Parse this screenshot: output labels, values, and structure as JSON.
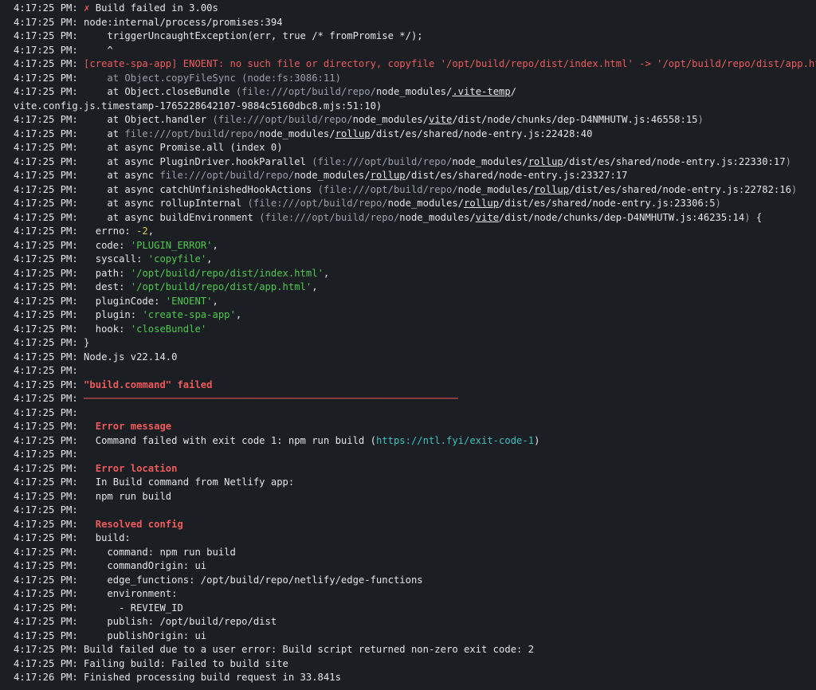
{
  "log": {
    "lines": [
      {
        "ts": "4:17:25 PM:",
        "segs": [
          {
            "t": " "
          },
          {
            "t": "✗",
            "c": "red"
          },
          {
            "t": " Build failed in 3.00s"
          }
        ]
      },
      {
        "ts": "4:17:25 PM:",
        "segs": [
          {
            "t": " node:internal/process/promises:394"
          }
        ]
      },
      {
        "ts": "4:17:25 PM:",
        "segs": [
          {
            "t": "     triggerUncaughtException(err, true /* fromPromise */);"
          }
        ]
      },
      {
        "ts": "4:17:25 PM:",
        "segs": [
          {
            "t": "     ^"
          }
        ]
      },
      {
        "ts": "4:17:25 PM:",
        "segs": [
          {
            "t": " [create-spa-app] ENOENT: no such file or directory, copyfile '/opt/build/repo/dist/index.html' -> '/opt/build/repo/dist/app.html'",
            "c": "red"
          }
        ]
      },
      {
        "ts": "4:17:25 PM:",
        "segs": [
          {
            "t": "     at Object.copyFileSync (node:fs:3086:11)",
            "c": "dim"
          }
        ]
      },
      {
        "ts": "4:17:25 PM:",
        "segs": [
          {
            "t": "     at Object.closeBundle "
          },
          {
            "t": "(file:///opt/build/repo/",
            "c": "dim"
          },
          {
            "t": "node_modules/"
          },
          {
            "t": ".vite-temp",
            "c": "u"
          },
          {
            "t": "/"
          }
        ]
      },
      {
        "ts": "",
        "segs": [
          {
            "t": "vite.config.js.timestamp-1765228642107-9884c5160dbc8.mjs:51:10)"
          }
        ]
      },
      {
        "ts": "4:17:25 PM:",
        "segs": [
          {
            "t": "     at Object.handler "
          },
          {
            "t": "(file:///opt/build/repo/",
            "c": "dim"
          },
          {
            "t": "node_modules/"
          },
          {
            "t": "vite",
            "c": "u"
          },
          {
            "t": "/dist/node/chunks/dep-D4NMHUTW.js:46558:15"
          },
          {
            "t": ")",
            "c": "dim"
          }
        ]
      },
      {
        "ts": "4:17:25 PM:",
        "segs": [
          {
            "t": "     at "
          },
          {
            "t": "file:///opt/build/repo/",
            "c": "dim"
          },
          {
            "t": "node_modules/"
          },
          {
            "t": "rollup",
            "c": "u"
          },
          {
            "t": "/dist/es/shared/node-entry.js:22428:40"
          }
        ]
      },
      {
        "ts": "4:17:25 PM:",
        "segs": [
          {
            "t": "     at async Promise.all (index 0)"
          }
        ]
      },
      {
        "ts": "4:17:25 PM:",
        "segs": [
          {
            "t": "     at async PluginDriver.hookParallel "
          },
          {
            "t": "(file:///opt/build/repo/",
            "c": "dim"
          },
          {
            "t": "node_modules/"
          },
          {
            "t": "rollup",
            "c": "u"
          },
          {
            "t": "/dist/es/shared/node-entry.js:22330:17"
          },
          {
            "t": ")",
            "c": "dim"
          }
        ]
      },
      {
        "ts": "4:17:25 PM:",
        "segs": [
          {
            "t": "     at async "
          },
          {
            "t": "file:///opt/build/repo/",
            "c": "dim"
          },
          {
            "t": "node_modules/"
          },
          {
            "t": "rollup",
            "c": "u"
          },
          {
            "t": "/dist/es/shared/node-entry.js:23327:17"
          }
        ]
      },
      {
        "ts": "4:17:25 PM:",
        "segs": [
          {
            "t": "     at async catchUnfinishedHookActions "
          },
          {
            "t": "(file:///opt/build/repo/",
            "c": "dim"
          },
          {
            "t": "node_modules/"
          },
          {
            "t": "rollup",
            "c": "u"
          },
          {
            "t": "/dist/es/shared/node-entry.js:22782:16"
          },
          {
            "t": ")",
            "c": "dim"
          }
        ]
      },
      {
        "ts": "4:17:25 PM:",
        "segs": [
          {
            "t": "     at async rollupInternal "
          },
          {
            "t": "(file:///opt/build/repo/",
            "c": "dim"
          },
          {
            "t": "node_modules/"
          },
          {
            "t": "rollup",
            "c": "u"
          },
          {
            "t": "/dist/es/shared/node-entry.js:23306:5"
          },
          {
            "t": ")",
            "c": "dim"
          }
        ]
      },
      {
        "ts": "4:17:25 PM:",
        "segs": [
          {
            "t": "     at async buildEnvironment "
          },
          {
            "t": "(file:///opt/build/repo/",
            "c": "dim"
          },
          {
            "t": "node_modules/"
          },
          {
            "t": "vite",
            "c": "u"
          },
          {
            "t": "/dist/node/chunks/dep-D4NMHUTW.js:46235:14"
          },
          {
            "t": ")",
            "c": "dim"
          },
          {
            "t": " {"
          }
        ]
      },
      {
        "ts": "4:17:25 PM:",
        "segs": [
          {
            "t": "   errno: "
          },
          {
            "t": "-2",
            "c": "num"
          },
          {
            "t": ","
          }
        ]
      },
      {
        "ts": "4:17:25 PM:",
        "segs": [
          {
            "t": "   code: "
          },
          {
            "t": "'PLUGIN_ERROR'",
            "c": "str"
          },
          {
            "t": ","
          }
        ]
      },
      {
        "ts": "4:17:25 PM:",
        "segs": [
          {
            "t": "   syscall: "
          },
          {
            "t": "'copyfile'",
            "c": "str"
          },
          {
            "t": ","
          }
        ]
      },
      {
        "ts": "4:17:25 PM:",
        "segs": [
          {
            "t": "   path: "
          },
          {
            "t": "'/opt/build/repo/dist/index.html'",
            "c": "str"
          },
          {
            "t": ","
          }
        ]
      },
      {
        "ts": "4:17:25 PM:",
        "segs": [
          {
            "t": "   dest: "
          },
          {
            "t": "'/opt/build/repo/dist/app.html'",
            "c": "str"
          },
          {
            "t": ","
          }
        ]
      },
      {
        "ts": "4:17:25 PM:",
        "segs": [
          {
            "t": "   pluginCode: "
          },
          {
            "t": "'ENOENT'",
            "c": "str"
          },
          {
            "t": ","
          }
        ]
      },
      {
        "ts": "4:17:25 PM:",
        "segs": [
          {
            "t": "   plugin: "
          },
          {
            "t": "'create-spa-app'",
            "c": "str"
          },
          {
            "t": ","
          }
        ]
      },
      {
        "ts": "4:17:25 PM:",
        "segs": [
          {
            "t": "   hook: "
          },
          {
            "t": "'closeBundle'",
            "c": "str"
          }
        ]
      },
      {
        "ts": "4:17:25 PM:",
        "segs": [
          {
            "t": " }"
          }
        ]
      },
      {
        "ts": "4:17:25 PM:",
        "segs": [
          {
            "t": " Node.js v22.14.0"
          }
        ]
      },
      {
        "ts": "4:17:25 PM:",
        "segs": []
      },
      {
        "ts": "4:17:25 PM:",
        "segs": [
          {
            "t": " \"build.command\" failed",
            "c": "redb"
          }
        ]
      },
      {
        "ts": "4:17:25 PM:",
        "segs": [
          {
            "t": " ────────────────────────────────────────────────────────────────",
            "c": "red"
          }
        ]
      },
      {
        "ts": "4:17:25 PM:",
        "segs": []
      },
      {
        "ts": "4:17:25 PM:",
        "segs": [
          {
            "t": "   "
          },
          {
            "t": "Error message",
            "c": "redb"
          }
        ]
      },
      {
        "ts": "4:17:25 PM:",
        "segs": [
          {
            "t": "   Command failed with exit code 1: npm run build ("
          },
          {
            "t": "https://ntl.fyi/exit-code-1",
            "c": "link"
          },
          {
            "t": ")"
          }
        ]
      },
      {
        "ts": "4:17:25 PM:",
        "segs": []
      },
      {
        "ts": "4:17:25 PM:",
        "segs": [
          {
            "t": "   "
          },
          {
            "t": "Error location",
            "c": "redb"
          }
        ]
      },
      {
        "ts": "4:17:25 PM:",
        "segs": [
          {
            "t": "   In Build command from Netlify app:"
          }
        ]
      },
      {
        "ts": "4:17:25 PM:",
        "segs": [
          {
            "t": "   npm run build"
          }
        ]
      },
      {
        "ts": "4:17:25 PM:",
        "segs": []
      },
      {
        "ts": "4:17:25 PM:",
        "segs": [
          {
            "t": "   "
          },
          {
            "t": "Resolved config",
            "c": "redb"
          }
        ]
      },
      {
        "ts": "4:17:25 PM:",
        "segs": [
          {
            "t": "   build:"
          }
        ]
      },
      {
        "ts": "4:17:25 PM:",
        "segs": [
          {
            "t": "     command: npm run build"
          }
        ]
      },
      {
        "ts": "4:17:25 PM:",
        "segs": [
          {
            "t": "     commandOrigin: ui"
          }
        ]
      },
      {
        "ts": "4:17:25 PM:",
        "segs": [
          {
            "t": "     edge_functions: /opt/build/repo/netlify/edge-functions"
          }
        ]
      },
      {
        "ts": "4:17:25 PM:",
        "segs": [
          {
            "t": "     environment:"
          }
        ]
      },
      {
        "ts": "4:17:25 PM:",
        "segs": [
          {
            "t": "       - REVIEW_ID"
          }
        ]
      },
      {
        "ts": "4:17:25 PM:",
        "segs": [
          {
            "t": "     publish: /opt/build/repo/dist"
          }
        ]
      },
      {
        "ts": "4:17:25 PM:",
        "segs": [
          {
            "t": "     publishOrigin: ui"
          }
        ]
      },
      {
        "ts": "4:17:25 PM:",
        "segs": [
          {
            "t": " Build failed due to a user error: Build script returned non-zero exit code: 2"
          }
        ]
      },
      {
        "ts": "4:17:25 PM:",
        "segs": [
          {
            "t": " Failing build: Failed to build site"
          }
        ]
      },
      {
        "ts": "4:17:26 PM:",
        "segs": [
          {
            "t": " Finished processing build request in 33.841s"
          }
        ]
      }
    ]
  },
  "colors": {
    "background": "#1b1e23",
    "text": "#e3e5e8",
    "error": "#ef5b5b",
    "dim": "#9aa0a8",
    "string": "#4ec94e",
    "number": "#d6c94a",
    "link": "#3ec0c0"
  }
}
